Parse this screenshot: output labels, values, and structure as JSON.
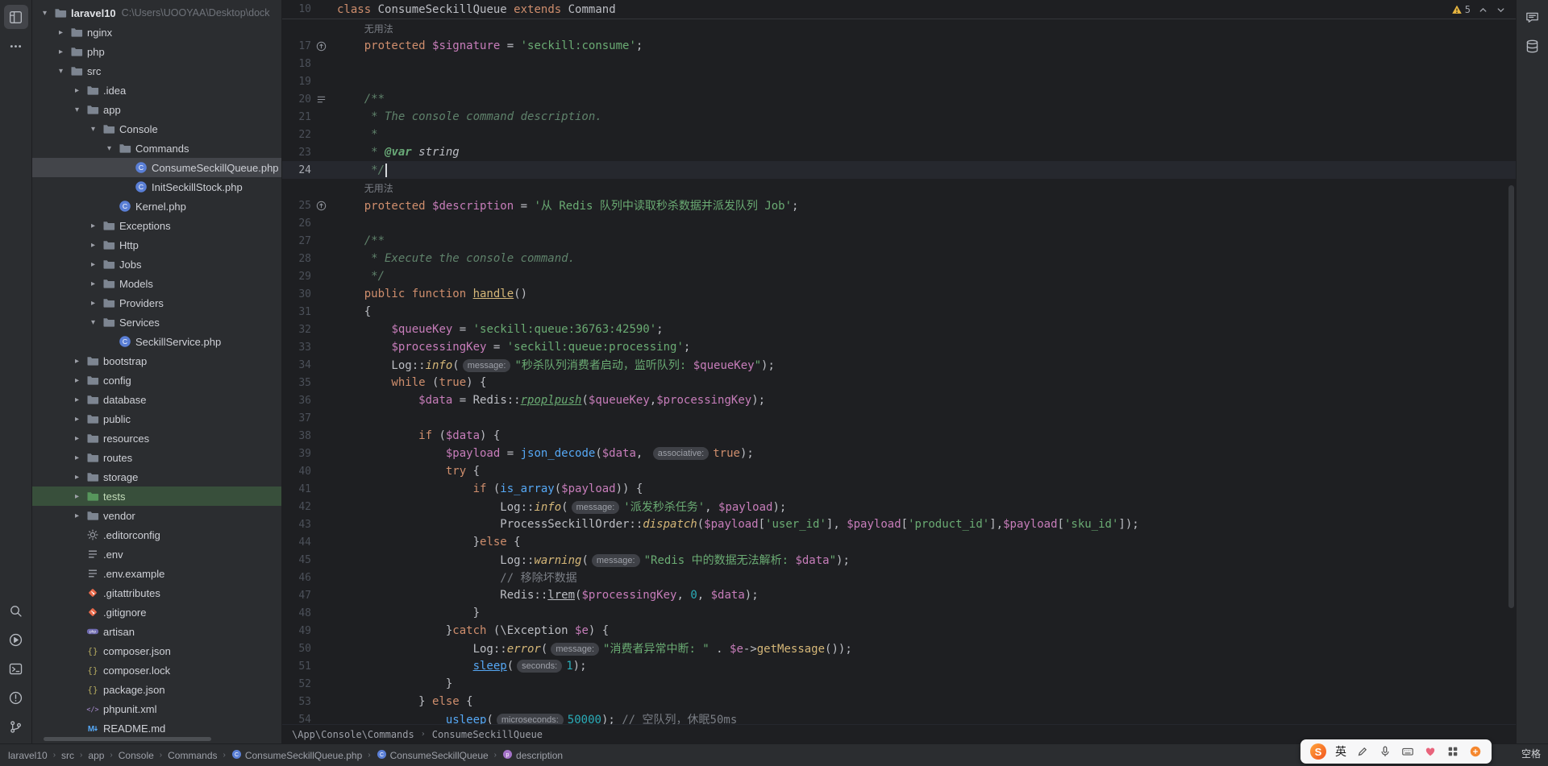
{
  "colors": {
    "editor_bg": "#1e1f22",
    "panel_bg": "#2b2d30",
    "keyword": "#cf8e6d",
    "string": "#6aab73",
    "variable": "#c77dba",
    "warning": "#e8b63f",
    "selection": "#43454a"
  },
  "activity_bar": {
    "top": [
      {
        "name": "project-icon",
        "icon": "project",
        "active": true
      },
      {
        "name": "more-tools-icon",
        "icon": "more",
        "active": false
      }
    ],
    "bottom": [
      {
        "name": "search-icon",
        "icon": "search"
      },
      {
        "name": "run-icon",
        "icon": "run"
      },
      {
        "name": "terminal-icon",
        "icon": "terminal"
      },
      {
        "name": "problems-icon",
        "icon": "problems"
      },
      {
        "name": "version-control-icon",
        "icon": "vcs"
      }
    ]
  },
  "right_bar": {
    "icons": [
      {
        "name": "ai-assistant-icon",
        "icon": "ai"
      },
      {
        "name": "database-icon",
        "icon": "db"
      }
    ]
  },
  "project_panel": {
    "items": [
      {
        "label": "laravel10",
        "level": 0,
        "chev": "open",
        "icon": "folder",
        "root": true,
        "path": "C:\\Users\\UOOYAA\\Desktop\\dock"
      },
      {
        "label": "nginx",
        "level": 1,
        "chev": "closed",
        "icon": "folder"
      },
      {
        "label": "php",
        "level": 1,
        "chev": "closed",
        "icon": "folder"
      },
      {
        "label": "src",
        "level": 1,
        "chev": "open",
        "icon": "folder"
      },
      {
        "label": ".idea",
        "level": 2,
        "chev": "closed",
        "icon": "folder"
      },
      {
        "label": "app",
        "level": 2,
        "chev": "open",
        "icon": "folder"
      },
      {
        "label": "Console",
        "level": 3,
        "chev": "open",
        "icon": "folder"
      },
      {
        "label": "Commands",
        "level": 4,
        "chev": "open",
        "icon": "folder"
      },
      {
        "label": "ConsumeSeckillQueue.php",
        "level": 5,
        "chev": "none",
        "icon": "class",
        "sel": true
      },
      {
        "label": "InitSeckillStock.php",
        "level": 5,
        "chev": "none",
        "icon": "class"
      },
      {
        "label": "Kernel.php",
        "level": 4,
        "chev": "none",
        "icon": "class"
      },
      {
        "label": "Exceptions",
        "level": 3,
        "chev": "closed",
        "icon": "folder"
      },
      {
        "label": "Http",
        "level": 3,
        "chev": "closed",
        "icon": "folder"
      },
      {
        "label": "Jobs",
        "level": 3,
        "chev": "closed",
        "icon": "folder"
      },
      {
        "label": "Models",
        "level": 3,
        "chev": "closed",
        "icon": "folder"
      },
      {
        "label": "Providers",
        "level": 3,
        "chev": "closed",
        "icon": "folder"
      },
      {
        "label": "Services",
        "level": 3,
        "chev": "open",
        "icon": "folder"
      },
      {
        "label": "SeckillService.php",
        "level": 4,
        "chev": "none",
        "icon": "class"
      },
      {
        "label": "bootstrap",
        "level": 2,
        "chev": "closed",
        "icon": "folder"
      },
      {
        "label": "config",
        "level": 2,
        "chev": "closed",
        "icon": "folder"
      },
      {
        "label": "database",
        "level": 2,
        "chev": "closed",
        "icon": "folder"
      },
      {
        "label": "public",
        "level": 2,
        "chev": "closed",
        "icon": "folder"
      },
      {
        "label": "resources",
        "level": 2,
        "chev": "closed",
        "icon": "folder"
      },
      {
        "label": "routes",
        "level": 2,
        "chev": "closed",
        "icon": "folder"
      },
      {
        "label": "storage",
        "level": 2,
        "chev": "closed",
        "icon": "folder"
      },
      {
        "label": "tests",
        "level": 2,
        "chev": "closed",
        "icon": "folder-green",
        "green": true
      },
      {
        "label": "vendor",
        "level": 2,
        "chev": "closed",
        "icon": "folder"
      },
      {
        "label": ".editorconfig",
        "level": 2,
        "chev": "none",
        "icon": "gear"
      },
      {
        "label": ".env",
        "level": 2,
        "chev": "none",
        "icon": "envfile"
      },
      {
        "label": ".env.example",
        "level": 2,
        "chev": "none",
        "icon": "envfile"
      },
      {
        "label": ".gitattributes",
        "level": 2,
        "chev": "none",
        "icon": "git"
      },
      {
        "label": ".gitignore",
        "level": 2,
        "chev": "none",
        "icon": "git"
      },
      {
        "label": "artisan",
        "level": 2,
        "chev": "none",
        "icon": "php"
      },
      {
        "label": "composer.json",
        "level": 2,
        "chev": "none",
        "icon": "json"
      },
      {
        "label": "composer.lock",
        "level": 2,
        "chev": "none",
        "icon": "json"
      },
      {
        "label": "package.json",
        "level": 2,
        "chev": "none",
        "icon": "json"
      },
      {
        "label": "phpunit.xml",
        "level": 2,
        "chev": "none",
        "icon": "xml"
      },
      {
        "label": "README.md",
        "level": 2,
        "chev": "none",
        "icon": "md"
      }
    ]
  },
  "editor": {
    "sticky_line": {
      "number": "10",
      "seg": [
        [
          "k",
          "class"
        ],
        [
          "p",
          " ConsumeSeckillQueue "
        ],
        [
          "k",
          "extends"
        ],
        [
          "p",
          " Command"
        ]
      ]
    },
    "inspection": {
      "warning_count": "5"
    },
    "breadcrumbs": [
      "\\App\\Console\\Commands",
      "ConsumeSeckillQueue"
    ],
    "lines": [
      {
        "inlay": "无用法"
      },
      {
        "n": "17",
        "g": "ov",
        "seg": [
          [
            "k",
            "    protected "
          ],
          [
            "v",
            "$signature"
          ],
          [
            "p",
            " = "
          ],
          [
            "s",
            "'seckill:consume'"
          ],
          [
            "p",
            ";"
          ]
        ]
      },
      {
        "n": "18",
        "seg": []
      },
      {
        "n": "19",
        "seg": []
      },
      {
        "n": "20",
        "g": "ls",
        "seg": [
          [
            "d",
            "    /**"
          ]
        ]
      },
      {
        "n": "21",
        "seg": [
          [
            "d",
            "     * The console command description."
          ]
        ]
      },
      {
        "n": "22",
        "seg": [
          [
            "d",
            "     *"
          ]
        ]
      },
      {
        "n": "23",
        "seg": [
          [
            "d",
            "     * "
          ],
          [
            "dt",
            "@var"
          ],
          [
            "dy",
            " string"
          ]
        ]
      },
      {
        "n": "24",
        "cur": true,
        "seg": [
          [
            "d",
            "     */"
          ]
        ]
      },
      {
        "inlay": "无用法"
      },
      {
        "n": "25",
        "g": "ov",
        "seg": [
          [
            "k",
            "    protected "
          ],
          [
            "v",
            "$description"
          ],
          [
            "p",
            " = "
          ],
          [
            "s",
            "'从 Redis 队列中读取秒杀数据并派发队列 Job'"
          ],
          [
            "p",
            ";"
          ]
        ]
      },
      {
        "n": "26",
        "seg": []
      },
      {
        "n": "27",
        "seg": [
          [
            "d",
            "    /**"
          ]
        ]
      },
      {
        "n": "28",
        "seg": [
          [
            "d",
            "     * Execute the console command."
          ]
        ]
      },
      {
        "n": "29",
        "seg": [
          [
            "d",
            "     */"
          ]
        ]
      },
      {
        "n": "30",
        "seg": [
          [
            "k",
            "    public function "
          ],
          [
            "de",
            "handle"
          ],
          [
            "p",
            "()"
          ]
        ]
      },
      {
        "n": "31",
        "seg": [
          [
            "p",
            "    {"
          ]
        ]
      },
      {
        "n": "32",
        "seg": [
          [
            "p",
            "        "
          ],
          [
            "v",
            "$queueKey"
          ],
          [
            "p",
            " = "
          ],
          [
            "s",
            "'seckill:queue:36763:42590'"
          ],
          [
            "p",
            ";"
          ]
        ]
      },
      {
        "n": "33",
        "seg": [
          [
            "p",
            "        "
          ],
          [
            "v",
            "$processingKey"
          ],
          [
            "p",
            " = "
          ],
          [
            "s",
            "'seckill:queue:processing'"
          ],
          [
            "p",
            ";"
          ]
        ]
      },
      {
        "n": "34",
        "seg": [
          [
            "p",
            "        Log::"
          ],
          [
            "mi",
            "info"
          ],
          [
            "p",
            "("
          ],
          [
            "ch",
            "message:"
          ],
          [
            "s",
            "\"秒杀队列消费者启动，监听队列: "
          ],
          [
            "v",
            "$queueKey"
          ],
          [
            "s",
            "\""
          ],
          [
            "p",
            ");"
          ]
        ]
      },
      {
        "n": "35",
        "seg": [
          [
            "k",
            "        while"
          ],
          [
            "p",
            " ("
          ],
          [
            "k",
            "true"
          ],
          [
            "p",
            ") {"
          ]
        ]
      },
      {
        "n": "36",
        "seg": [
          [
            "p",
            "            "
          ],
          [
            "v",
            "$data"
          ],
          [
            "p",
            " = Redis::"
          ],
          [
            "g",
            "rpoplpush"
          ],
          [
            "p",
            "("
          ],
          [
            "v",
            "$queueKey"
          ],
          [
            "p",
            ","
          ],
          [
            "v",
            "$processingKey"
          ],
          [
            "p",
            ");"
          ]
        ]
      },
      {
        "n": "37",
        "seg": []
      },
      {
        "n": "38",
        "seg": [
          [
            "k",
            "            if"
          ],
          [
            "p",
            " ("
          ],
          [
            "v",
            "$data"
          ],
          [
            "p",
            ") {"
          ]
        ]
      },
      {
        "n": "39",
        "seg": [
          [
            "p",
            "                "
          ],
          [
            "v",
            "$payload"
          ],
          [
            "p",
            " = "
          ],
          [
            "f",
            "json_decode"
          ],
          [
            "p",
            "("
          ],
          [
            "v",
            "$data"
          ],
          [
            "p",
            ", "
          ],
          [
            "ch",
            "associative:"
          ],
          [
            "k",
            "true"
          ],
          [
            "p",
            ");"
          ]
        ]
      },
      {
        "n": "40",
        "seg": [
          [
            "k",
            "                try"
          ],
          [
            "p",
            " {"
          ]
        ]
      },
      {
        "n": "41",
        "seg": [
          [
            "k",
            "                    if"
          ],
          [
            "p",
            " ("
          ],
          [
            "f",
            "is_array"
          ],
          [
            "p",
            "("
          ],
          [
            "v",
            "$payload"
          ],
          [
            "p",
            ")) {"
          ]
        ]
      },
      {
        "n": "42",
        "seg": [
          [
            "p",
            "                        Log::"
          ],
          [
            "mi",
            "info"
          ],
          [
            "p",
            "("
          ],
          [
            "ch",
            "message:"
          ],
          [
            "s",
            "'派发秒杀任务'"
          ],
          [
            "p",
            ", "
          ],
          [
            "v",
            "$payload"
          ],
          [
            "p",
            ");"
          ]
        ]
      },
      {
        "n": "43",
        "seg": [
          [
            "p",
            "                        ProcessSeckillOrder::"
          ],
          [
            "mi",
            "dispatch"
          ],
          [
            "p",
            "("
          ],
          [
            "v",
            "$payload"
          ],
          [
            "p",
            "["
          ],
          [
            "s",
            "'user_id'"
          ],
          [
            "p",
            "], "
          ],
          [
            "v",
            "$payload"
          ],
          [
            "p",
            "["
          ],
          [
            "s",
            "'product_id'"
          ],
          [
            "p",
            "],"
          ],
          [
            "v",
            "$payload"
          ],
          [
            "p",
            "["
          ],
          [
            "s",
            "'sku_id'"
          ],
          [
            "p",
            "]);"
          ]
        ]
      },
      {
        "n": "44",
        "seg": [
          [
            "p",
            "                    }"
          ],
          [
            "k",
            "else"
          ],
          [
            "p",
            " {"
          ]
        ]
      },
      {
        "n": "45",
        "seg": [
          [
            "p",
            "                        Log::"
          ],
          [
            "mi",
            "warning"
          ],
          [
            "p",
            "("
          ],
          [
            "ch",
            "message:"
          ],
          [
            "s",
            "\"Redis 中的数据无法解析: "
          ],
          [
            "v",
            "$data"
          ],
          [
            "s",
            "\""
          ],
          [
            "p",
            ");"
          ]
        ]
      },
      {
        "n": "46",
        "seg": [
          [
            "c",
            "                        // 移除坏数据"
          ]
        ]
      },
      {
        "n": "47",
        "seg": [
          [
            "p",
            "                        Redis::"
          ],
          [
            "u",
            "lrem"
          ],
          [
            "p",
            "("
          ],
          [
            "v",
            "$processingKey"
          ],
          [
            "p",
            ", "
          ],
          [
            "nu",
            "0"
          ],
          [
            "p",
            ", "
          ],
          [
            "v",
            "$data"
          ],
          [
            "p",
            ");"
          ]
        ]
      },
      {
        "n": "48",
        "seg": [
          [
            "p",
            "                    }"
          ]
        ]
      },
      {
        "n": "49",
        "seg": [
          [
            "p",
            "                }"
          ],
          [
            "k",
            "catch"
          ],
          [
            "p",
            " (\\Exception "
          ],
          [
            "v",
            "$e"
          ],
          [
            "p",
            ") {"
          ]
        ]
      },
      {
        "n": "50",
        "seg": [
          [
            "p",
            "                    Log::"
          ],
          [
            "mi",
            "error"
          ],
          [
            "p",
            "("
          ],
          [
            "ch",
            "message:"
          ],
          [
            "s",
            "\"消费者异常中断: \""
          ],
          [
            "p",
            " . "
          ],
          [
            "v",
            "$e"
          ],
          [
            "p",
            "->"
          ],
          [
            "m",
            "getMessage"
          ],
          [
            "p",
            "());"
          ]
        ]
      },
      {
        "n": "51",
        "seg": [
          [
            "p",
            "                    "
          ],
          [
            "fu",
            "sleep"
          ],
          [
            "p",
            "("
          ],
          [
            "ch",
            "seconds:"
          ],
          [
            "nu",
            "1"
          ],
          [
            "p",
            ");"
          ]
        ]
      },
      {
        "n": "52",
        "seg": [
          [
            "p",
            "                }"
          ]
        ]
      },
      {
        "n": "53",
        "seg": [
          [
            "p",
            "            } "
          ],
          [
            "k",
            "else"
          ],
          [
            "p",
            " {"
          ]
        ]
      },
      {
        "n": "54",
        "seg": [
          [
            "p",
            "                "
          ],
          [
            "fu",
            "usleep"
          ],
          [
            "p",
            "("
          ],
          [
            "ch",
            "microseconds:"
          ],
          [
            "nu",
            "50000"
          ],
          [
            "p",
            ");"
          ],
          [
            "c",
            " // 空队列，休眠50ms"
          ]
        ]
      }
    ]
  },
  "status_bar": {
    "nav": [
      {
        "label": "laravel10"
      },
      {
        "label": "src"
      },
      {
        "label": "app"
      },
      {
        "label": "Console"
      },
      {
        "label": "Commands"
      },
      {
        "label": "ConsumeSeckillQueue.php",
        "icon": "class"
      },
      {
        "label": "ConsumeSeckillQueue",
        "icon": "class"
      },
      {
        "label": "description",
        "icon": "property"
      }
    ],
    "ime": {
      "mode": "英",
      "tools": [
        "pen-icon",
        "mic-icon",
        "keyboard-icon",
        "skin-icon",
        "toolbox-icon",
        "gift-icon"
      ]
    },
    "indent_label": "空格"
  }
}
